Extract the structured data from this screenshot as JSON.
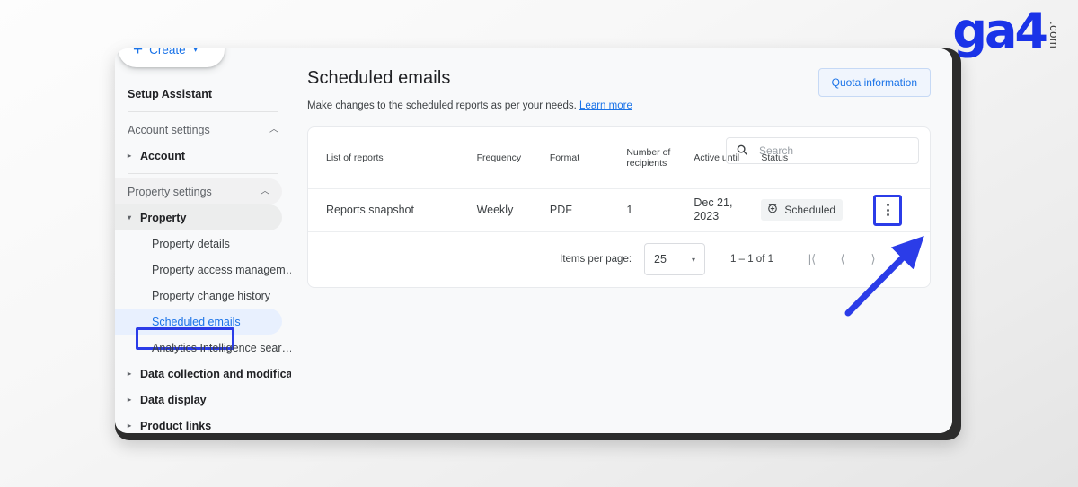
{
  "brand": {
    "wordmark": "ga4",
    "suffix": ".com",
    "accent_blue": "#1a33e8"
  },
  "sidebar": {
    "create_button": {
      "label": "Create",
      "plus": "+",
      "caret": "▾"
    },
    "items": [
      {
        "label": "Setup Assistant",
        "type": "bold",
        "arrow": ""
      },
      {
        "label": "Account settings",
        "type": "section",
        "caret": "︿"
      },
      {
        "label": "Account",
        "type": "bold",
        "arrow": "▸"
      },
      {
        "label": "Property settings",
        "type": "section-tinted",
        "caret": "︿"
      },
      {
        "label": "Property",
        "type": "pill-bold",
        "arrow": "▾"
      },
      {
        "label": "Property details",
        "type": "child"
      },
      {
        "label": "Property access managem…",
        "type": "child"
      },
      {
        "label": "Property change history",
        "type": "child"
      },
      {
        "label": "Scheduled emails",
        "type": "child-active"
      },
      {
        "label": "Analytics Intelligence sear…",
        "type": "child"
      },
      {
        "label": "Data collection and modifica…",
        "type": "bold",
        "arrow": "▸"
      },
      {
        "label": "Data display",
        "type": "bold",
        "arrow": "▸"
      },
      {
        "label": "Product links",
        "type": "bold",
        "arrow": "▸"
      }
    ]
  },
  "header": {
    "title": "Scheduled emails",
    "subtitle": "Make changes to the scheduled reports as per your needs.",
    "learn_more": "Learn more",
    "quota_button": "Quota information"
  },
  "search": {
    "placeholder": "Search",
    "value": "",
    "icon": "search-icon"
  },
  "table": {
    "columns": [
      "List of reports",
      "Frequency",
      "Format",
      "Number of recipients",
      "Active until",
      "Status",
      ""
    ],
    "rows": [
      {
        "report": "Reports snapshot",
        "frequency": "Weekly",
        "format": "PDF",
        "recipients": "1",
        "active_until": "Dec 21, 2023",
        "status": "Scheduled",
        "status_icon": "alarm-clock-icon",
        "menu_icon": "more-vert-icon"
      }
    ]
  },
  "pagination": {
    "items_per_page_label": "Items per page:",
    "items_per_page_value": "25",
    "caret": "▾",
    "range": "1 – 1 of 1",
    "first": "|⟨",
    "prev": "⟨",
    "next": "⟩",
    "last": "⟩|"
  },
  "annotations": {
    "highlight_color": "#2b3ce8",
    "boxes": [
      "scheduled-emails-nav-item",
      "row-overflow-menu"
    ],
    "arrow": "points-to-row-overflow-menu"
  }
}
